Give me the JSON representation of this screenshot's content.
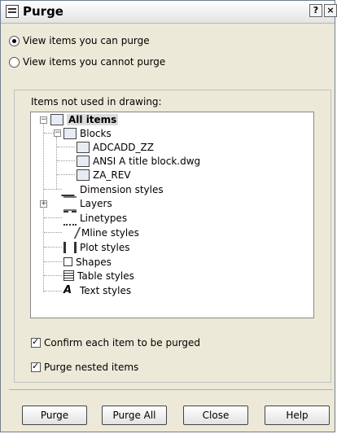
{
  "window": {
    "title": "Purge",
    "help_glyph": "?",
    "close_glyph": "×"
  },
  "view_options": [
    {
      "label": "View items you can purge",
      "selected": true
    },
    {
      "label": "View items you cannot purge",
      "selected": false
    }
  ],
  "tree_group": {
    "label": "Items not used in drawing:",
    "root": "All items",
    "blocks": "Blocks",
    "block_items": [
      "ADCADD_ZZ",
      "ANSI A title block.dwg",
      "ZA_REV"
    ],
    "others": [
      "Dimension styles",
      "Layers",
      "Linetypes",
      "Mline styles",
      "Plot styles",
      "Shapes",
      "Table styles",
      "Text styles"
    ]
  },
  "options": {
    "confirm": "Confirm each item to be purged",
    "nested": "Purge nested items"
  },
  "buttons": {
    "purge": "Purge",
    "purge_all": "Purge All",
    "close": "Close",
    "help": "Help"
  }
}
